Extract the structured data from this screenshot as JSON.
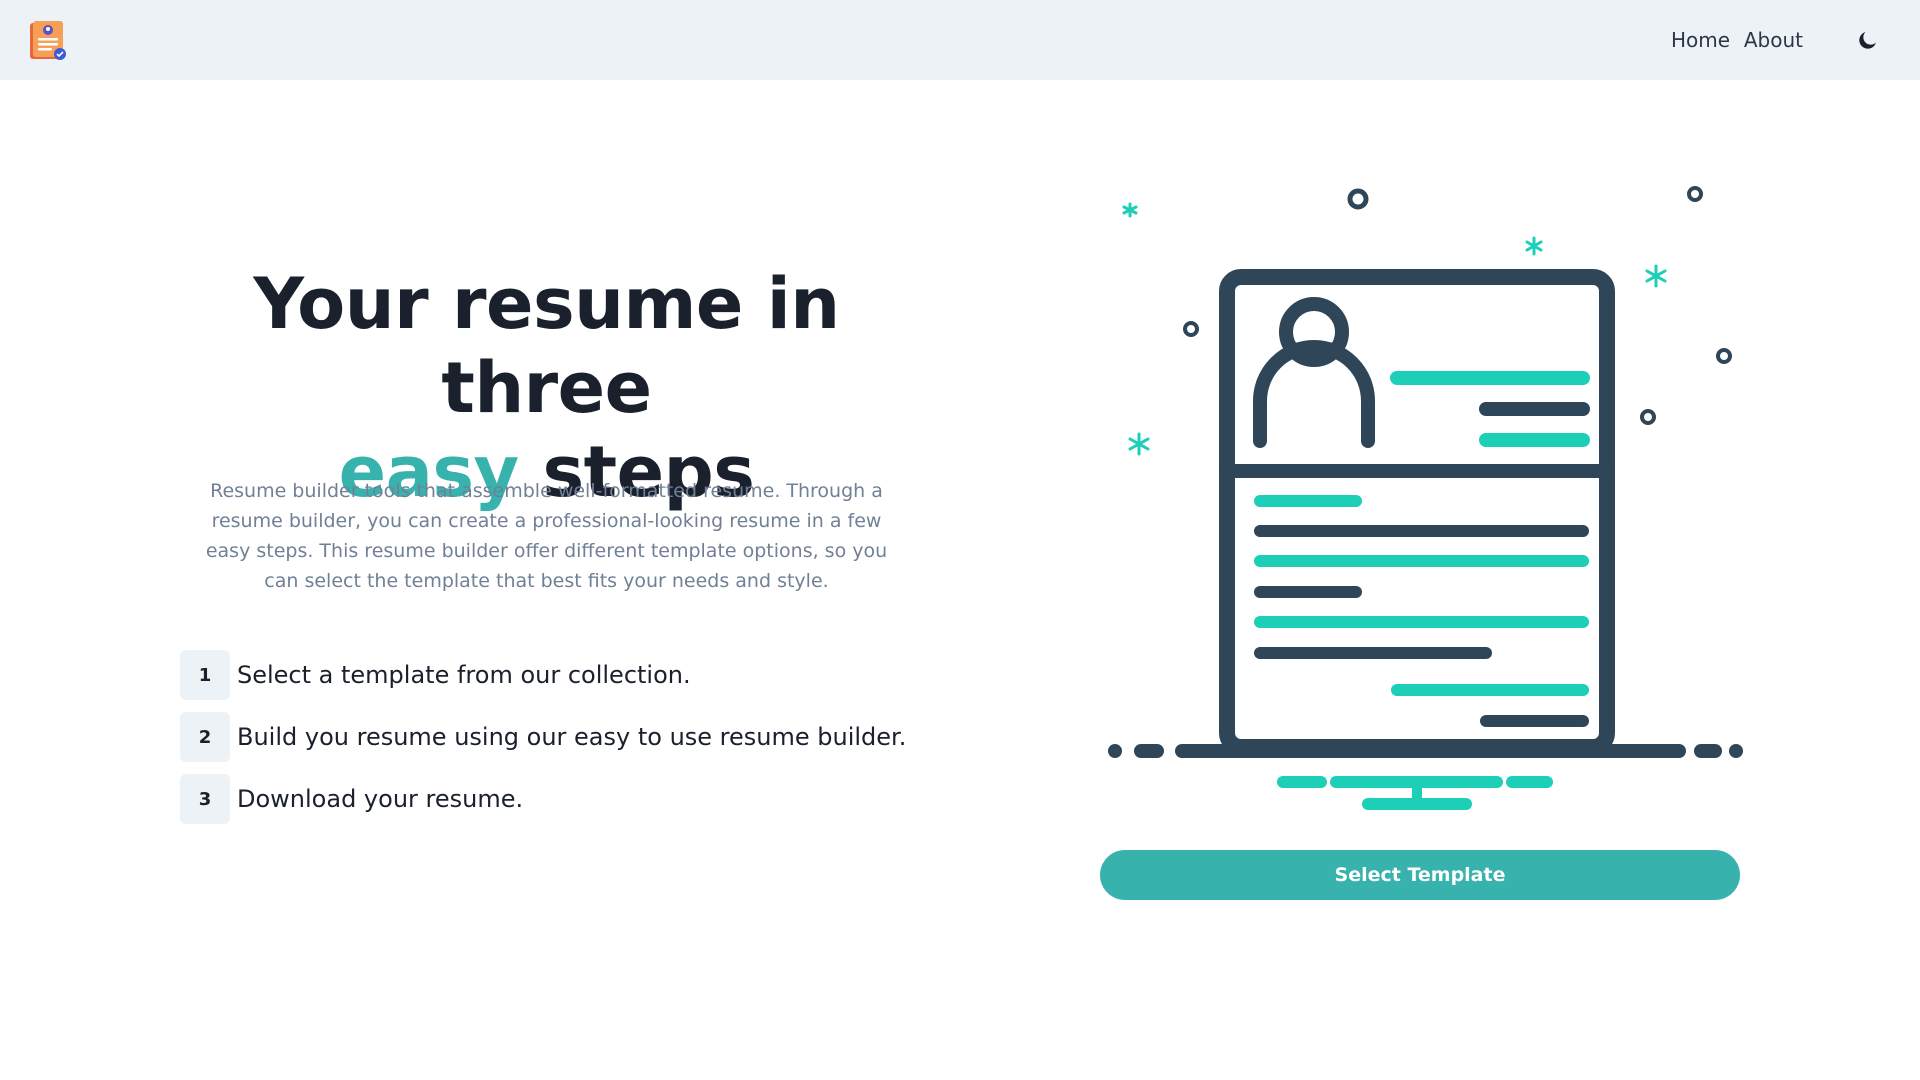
{
  "nav": {
    "logo": "resume-logo-icon",
    "home_label": "Home",
    "about_label": "About",
    "theme_icon": "moon-icon"
  },
  "hero": {
    "title_line1": "Your resume in three",
    "title_accent": "easy",
    "title_line2_rest": " steps",
    "description": "Resume builder tools that assemble well-formatted resume. Through a resume builder, you can create a professional-looking resume in a few easy steps. This resume builder offer different template options, so you can select the template that best fits your needs and style."
  },
  "steps": [
    {
      "number": "1",
      "text": "Select a template from our collection."
    },
    {
      "number": "2",
      "text": "Build you resume using our easy to use resume builder."
    },
    {
      "number": "3",
      "text": "Download your resume."
    }
  ],
  "cta": {
    "label": "Select Template"
  },
  "colors": {
    "accent": "#38b2ac",
    "teal_illustration": "#1ccfb6",
    "navy": "#2f4558",
    "navbar_bg": "#edf2f7",
    "text_dark": "#1a202c",
    "text_muted": "#718096"
  },
  "illustration": {
    "icon": "resume-document-illustration"
  }
}
